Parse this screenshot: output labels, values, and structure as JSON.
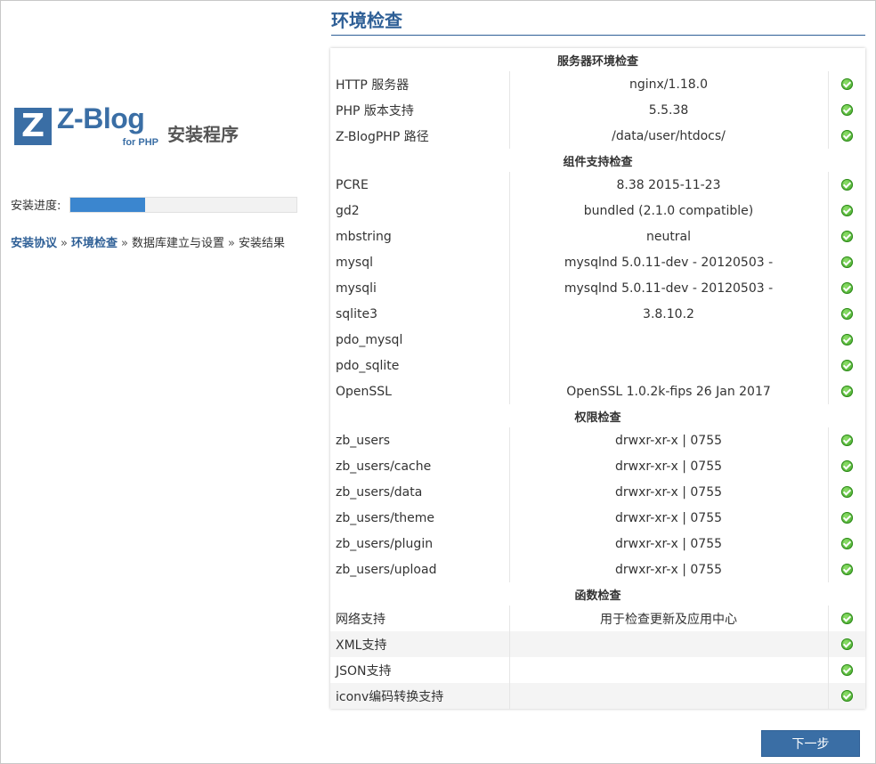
{
  "logo": {
    "mark": "Z",
    "brand": "Z-Blog",
    "sub": "for PHP",
    "install": "安装程序"
  },
  "progress": {
    "label": "安装进度:",
    "fraction": 0.33
  },
  "steps": [
    {
      "label": "安装协议",
      "done": true
    },
    {
      "label": "环境检查",
      "done": true
    },
    {
      "label": "数据库建立与设置",
      "done": false
    },
    {
      "label": "安装结果",
      "done": false
    }
  ],
  "step_separator": "»",
  "page_title": "环境检查",
  "sections": [
    {
      "title": "服务器环境检查",
      "rows": [
        {
          "name": "HTTP 服务器",
          "value": "nginx/1.18.0"
        },
        {
          "name": "PHP 版本支持",
          "value": "5.5.38"
        },
        {
          "name": "Z-BlogPHP 路径",
          "value": "/data/user/htdocs/"
        }
      ]
    },
    {
      "title": "组件支持检查",
      "rows": [
        {
          "name": "PCRE",
          "value": "8.38 2015-11-23"
        },
        {
          "name": "gd2",
          "value": "bundled (2.1.0 compatible)"
        },
        {
          "name": "mbstring",
          "value": "neutral"
        },
        {
          "name": "mysql",
          "value": "mysqlnd 5.0.11-dev - 20120503 -"
        },
        {
          "name": "mysqli",
          "value": "mysqlnd 5.0.11-dev - 20120503 -"
        },
        {
          "name": "sqlite3",
          "value": "3.8.10.2"
        },
        {
          "name": "pdo_mysql",
          "value": ""
        },
        {
          "name": "pdo_sqlite",
          "value": ""
        },
        {
          "name": "OpenSSL",
          "value": "OpenSSL 1.0.2k-fips 26 Jan 2017"
        }
      ]
    },
    {
      "title": "权限检查",
      "rows": [
        {
          "name": "zb_users",
          "value": "drwxr-xr-x | 0755"
        },
        {
          "name": "zb_users/cache",
          "value": "drwxr-xr-x | 0755"
        },
        {
          "name": "zb_users/data",
          "value": "drwxr-xr-x | 0755"
        },
        {
          "name": "zb_users/theme",
          "value": "drwxr-xr-x | 0755"
        },
        {
          "name": "zb_users/plugin",
          "value": "drwxr-xr-x | 0755"
        },
        {
          "name": "zb_users/upload",
          "value": "drwxr-xr-x | 0755"
        }
      ]
    },
    {
      "title": "函数检查",
      "rows": [
        {
          "name": "网络支持",
          "value": "用于检查更新及应用中心"
        },
        {
          "name": "XML支持",
          "value": ""
        },
        {
          "name": "JSON支持",
          "value": ""
        },
        {
          "name": "iconv编码转换支持",
          "value": ""
        }
      ]
    }
  ],
  "status_icon": "check-circle-icon",
  "next_button": "下一步",
  "colors": {
    "accent": "#3a6ea5",
    "progress": "#3b86cf",
    "ok": "#3aa123"
  }
}
